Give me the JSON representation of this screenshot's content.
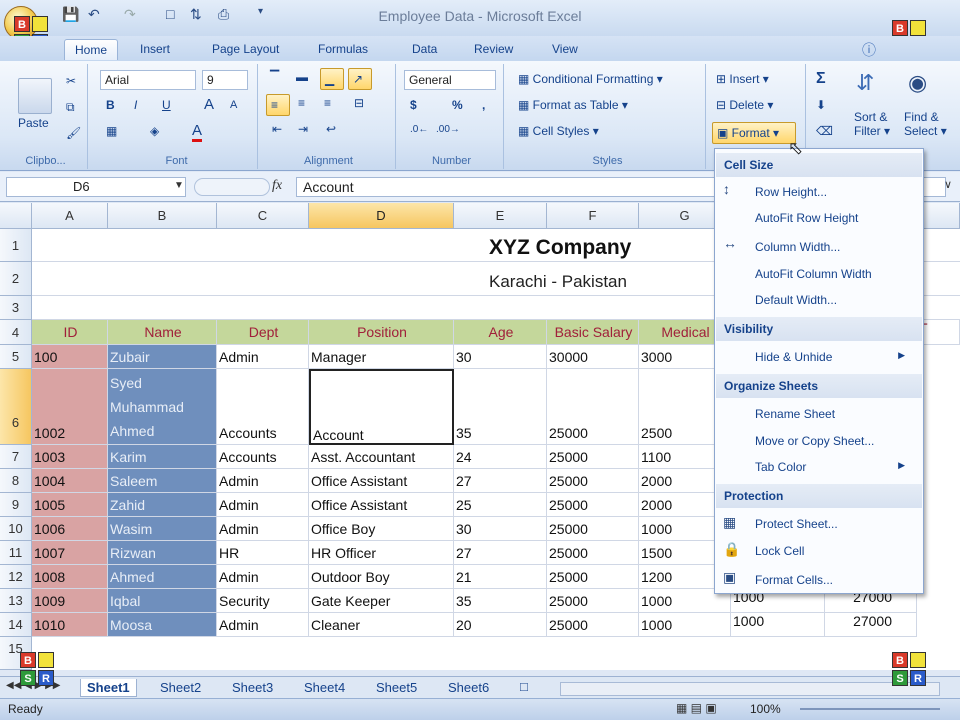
{
  "window": {
    "title": "Employee Data - Microsoft Excel"
  },
  "tabs": [
    "Home",
    "Insert",
    "Page Layout",
    "Formulas",
    "Data",
    "Review",
    "View"
  ],
  "ribbon": {
    "clipboard": {
      "label": "Clipbo...",
      "paste": "Paste"
    },
    "font": {
      "label": "Font",
      "name": "Arial",
      "size": "9",
      "bold": "B",
      "italic": "I",
      "underline": "U",
      "grow": "A",
      "shrink": "A",
      "color_a": "A"
    },
    "alignment": {
      "label": "Alignment"
    },
    "number": {
      "label": "Number",
      "format": "General",
      "currency": "$",
      "percent": "%",
      "comma": ","
    },
    "styles": {
      "label": "Styles",
      "conditional": "Conditional Formatting",
      "format_table": "Format as Table",
      "cell_styles": "Cell Styles"
    },
    "cells": {
      "insert": "Insert",
      "delete": "Delete",
      "format": "Format"
    },
    "editing": {
      "sigma": "Σ",
      "sort": "Sort &",
      "sort2": "Filter",
      "find": "Find &",
      "find2": "Select"
    }
  },
  "formula": {
    "name_box": "D6",
    "fx": "fx",
    "value": "Account"
  },
  "columns": [
    "A",
    "B",
    "C",
    "D",
    "E",
    "F",
    "G"
  ],
  "sheet": {
    "company": "XYZ Company",
    "location": "Karachi - Pakistan",
    "headers": [
      "ID",
      "Name",
      "Dept",
      "Position",
      "Age",
      "Basic Salary",
      "Medical"
    ],
    "rows": [
      [
        "100",
        "Zubair",
        "Admin",
        "Manager",
        "30",
        "30000",
        "3000"
      ],
      [
        "1002",
        "Syed Muhammad Ahmed",
        "Accounts",
        "Account",
        "35",
        "25000",
        "2500"
      ],
      [
        "1003",
        "Karim",
        "Accounts",
        "Asst. Accountant",
        "24",
        "25000",
        "1100"
      ],
      [
        "1004",
        "Saleem",
        "Admin",
        "Office Assistant",
        "27",
        "25000",
        "2000"
      ],
      [
        "1005",
        "Zahid",
        "Admin",
        "Office Assistant",
        "25",
        "25000",
        "2000"
      ],
      [
        "1006",
        "Wasim",
        "Admin",
        "Office Boy",
        "30",
        "25000",
        "1000"
      ],
      [
        "1007",
        "Rizwan",
        "HR",
        "HR Officer",
        "27",
        "25000",
        "1500"
      ],
      [
        "1008",
        "Ahmed",
        "Admin",
        "Outdoor Boy",
        "21",
        "25000",
        "1200"
      ],
      [
        "1009",
        "Iqbal",
        "Security",
        "Gate Keeper",
        "35",
        "25000",
        "1000"
      ],
      [
        "1010",
        "Moosa",
        "Admin",
        "Cleaner",
        "20",
        "25000",
        "1000"
      ]
    ],
    "extra_h": [
      "1000",
      "1000"
    ],
    "extra_i": [
      "27000",
      "27000"
    ],
    "row_numbers": [
      "1",
      "2",
      "3",
      "4",
      "5",
      "6",
      "7",
      "8",
      "9",
      "10",
      "11",
      "12",
      "13",
      "14",
      "15"
    ],
    "t_col": "T"
  },
  "format_menu": {
    "cell_size": "Cell Size",
    "row_height": "Row Height...",
    "autofit_row": "AutoFit Row Height",
    "column_width": "Column Width...",
    "autofit_col": "AutoFit Column Width",
    "default_width": "Default Width...",
    "visibility": "Visibility",
    "hide_unhide": "Hide & Unhide",
    "organize": "Organize Sheets",
    "rename": "Rename Sheet",
    "move_copy": "Move or Copy Sheet...",
    "tab_color": "Tab Color",
    "protection": "Protection",
    "protect_sheet": "Protect Sheet...",
    "lock_cell": "Lock Cell",
    "format_cells": "Format Cells..."
  },
  "sheet_tabs": [
    "Sheet1",
    "Sheet2",
    "Sheet3",
    "Sheet4",
    "Sheet5",
    "Sheet6"
  ],
  "status": {
    "ready": "Ready",
    "zoom": "100%"
  },
  "logo": {
    "b": "B",
    "s": "S",
    "r": "R"
  }
}
